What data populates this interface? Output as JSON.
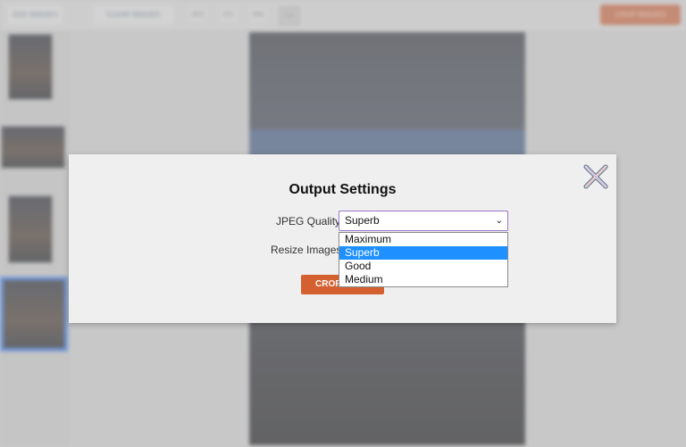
{
  "toolbar": {
    "left_buttons": [
      "ADD IMAGES",
      "CLEAR IMAGES"
    ],
    "small_buttons": [
      "16:9",
      "4:3",
      "free",
      "1:1"
    ],
    "primary_action": "CROP IMAGES"
  },
  "modal": {
    "title": "Output Settings",
    "jpeg_quality_label": "JPEG Quality:",
    "jpeg_quality_value": "Superb",
    "resize_label": "Resize Images:",
    "quality_options": [
      "Maximum",
      "Superb",
      "Good",
      "Medium"
    ],
    "selected_option_index": 1,
    "crop_button_label": "CROP"
  },
  "colors": {
    "accent": "#d4602f",
    "selected_option": "#1e90ff",
    "select_focus_border": "#9b76c9"
  }
}
